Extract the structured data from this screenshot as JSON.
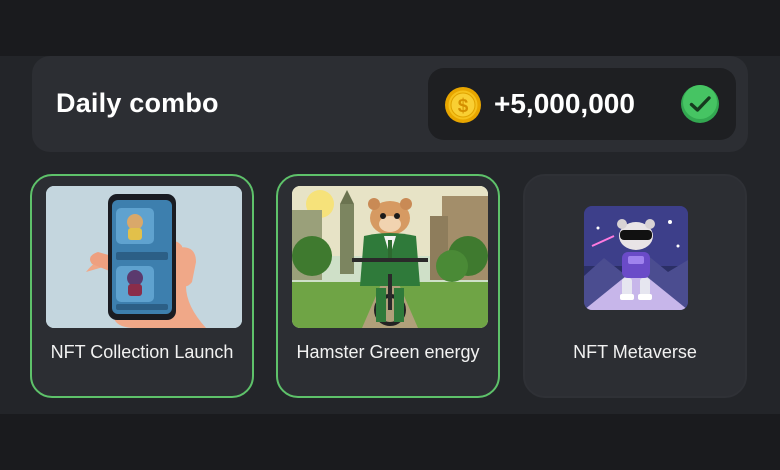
{
  "combo": {
    "title": "Daily combo",
    "reward_amount": "+5,000,000",
    "coin_icon": "coin-icon",
    "check_icon": "check-circle-icon",
    "check_color": "#3fbf5a",
    "coin_color": "#f2b705"
  },
  "cards": [
    {
      "label": "NFT Collection Launch",
      "image": "phone-nft-collection-image"
    },
    {
      "label": "Hamster Green energy",
      "image": "hamster-bicycle-image"
    },
    {
      "label": "NFT Metaverse",
      "image": "hamster-metaverse-image"
    }
  ],
  "colors": {
    "card_border_active": "#5ec26a",
    "card_bg": "#2c2e33",
    "page_bg": "#232529"
  }
}
